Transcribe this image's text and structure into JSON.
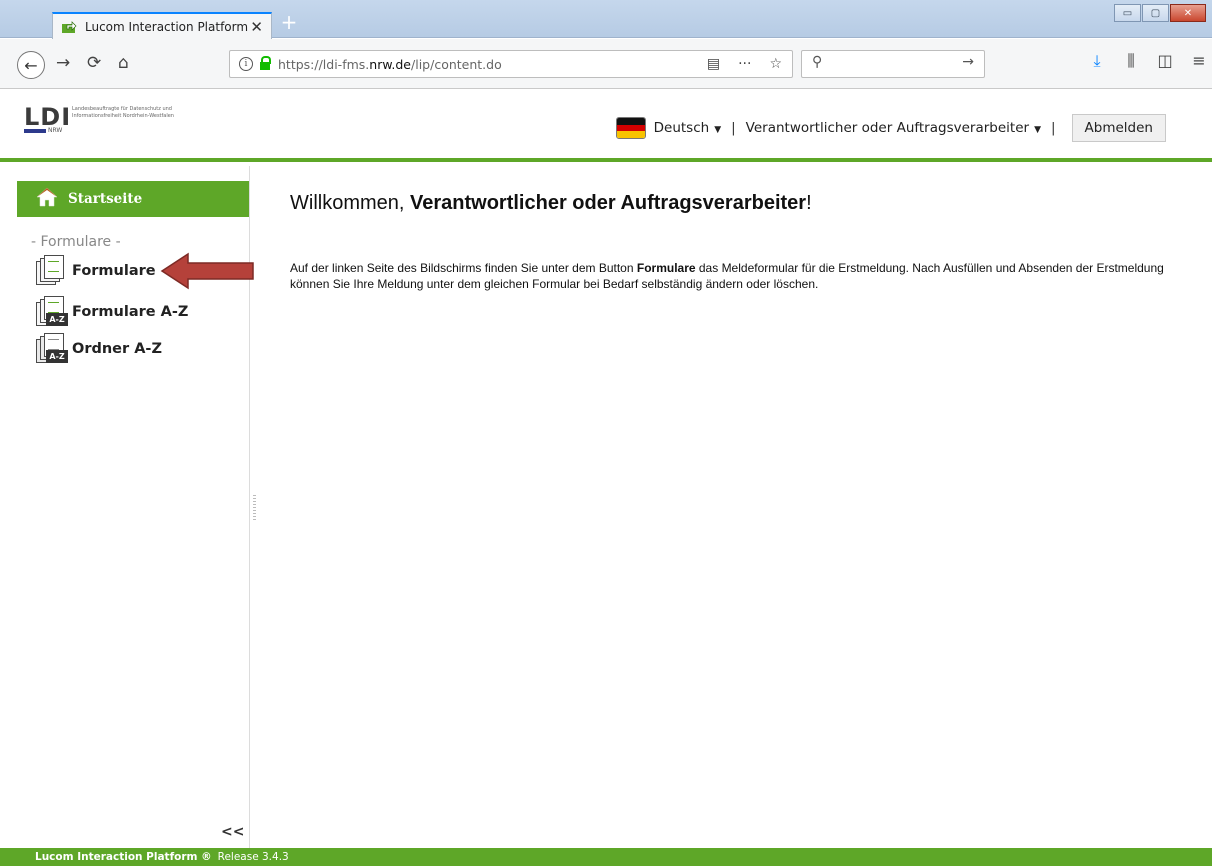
{
  "browser": {
    "tab_title": "Lucom Interaction Platform",
    "tab_close": "✕",
    "new_tab": "+",
    "url_prefix": "https://ldi-fms.",
    "url_domain": "nrw.de",
    "url_path": "/lip/content.do",
    "window_controls": {
      "minimize": "▭",
      "maximize": "▢",
      "close": "✕"
    }
  },
  "header": {
    "logo_text": "LDI",
    "logo_region": "NRW",
    "logo_subtitle": "Landesbeauftragte für Datenschutz und Informationsfreiheit Nordrhein-Westfalen",
    "language": "Deutsch",
    "role": "Verantwortlicher oder Auftragsverarbeiter",
    "separator": "|",
    "logout": "Abmelden"
  },
  "sidebar": {
    "home_label": "Startseite",
    "section_label": "- Formulare -",
    "items": [
      {
        "label": "Formulare",
        "icon": "forms-icon"
      },
      {
        "label": "Formulare A-Z",
        "icon": "forms-az-icon",
        "badge": "A-Z"
      },
      {
        "label": "Ordner A-Z",
        "icon": "folders-az-icon",
        "badge": "A-Z"
      }
    ],
    "collapse_label": "<<"
  },
  "main": {
    "welcome_prefix": "Willkommen, ",
    "welcome_role": "Verantwortlicher oder Auftragsverarbeiter",
    "welcome_suffix": "!",
    "info_part1": "Auf der linken Seite des Bildschirms finden Sie unter dem Button ",
    "info_bold": "Formulare",
    "info_part2": " das Meldeformular für die Erstmeldung. Nach Ausfüllen und Absenden der Erstmeldung können Sie Ihre Meldung unter dem gleichen Formular bei Bedarf selbständig ändern oder löschen."
  },
  "footer": {
    "brand": "Lucom Interaction Platform ®",
    "release": "Release 3.4.3"
  },
  "colors": {
    "accent_green": "#5ea728",
    "arrow_red": "#b5413a",
    "browser_blue": "#0a84ff"
  }
}
